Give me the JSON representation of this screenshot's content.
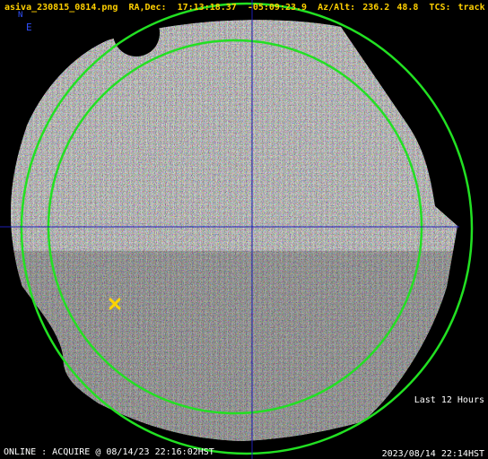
{
  "header": {
    "filename": "asiva_230815_0814.png",
    "radec_label": "RA,Dec:",
    "ra": "17:13:18.37",
    "dec": "-05:09:23.9",
    "azalt_label": "Az/Alt:",
    "az": "236.2",
    "alt": "48.8",
    "tcs_label": "TCS:",
    "tcs_state": "track"
  },
  "compass": {
    "north": "N",
    "east": "E"
  },
  "overlay": {
    "history_label": "Last 12 Hours"
  },
  "footer": {
    "status": "ONLINE : ACQUIRE @ 08/14/23 22:16:02HST",
    "timestamp": "2023/08/14 22:14HST"
  },
  "colors": {
    "header_text": "#ffd000",
    "circle": "#22e022",
    "crosshair": "#1e1eb4",
    "marker": "#ffd400",
    "compass": "#3050ff"
  },
  "icons": {
    "target_marker": "x-marker-icon"
  }
}
